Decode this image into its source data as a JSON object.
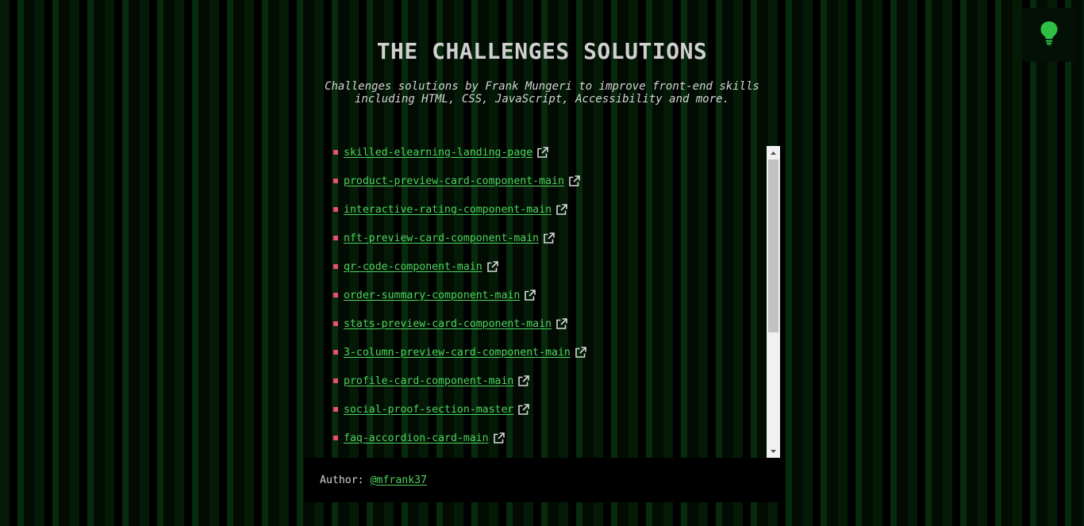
{
  "header": {
    "title": "THE CHALLENGES SOLUTIONS",
    "subtitle": "Challenges solutions by Frank Mungeri to improve front-end skills including HTML, CSS, JavaScript, Accessibility and more."
  },
  "theme_toggle": {
    "icon": "lightbulb-icon",
    "color": "#2fbf45"
  },
  "challenges": [
    "skilled-elearning-landing-page",
    "product-preview-card-component-main",
    "interactive-rating-component-main",
    "nft-preview-card-component-main",
    "qr-code-component-main",
    "order-summary-component-main",
    "stats-preview-card-component-main",
    "3-column-preview-card-component-main",
    "profile-card-component-main",
    "social-proof-section-master",
    "faq-accordion-card-main"
  ],
  "footer": {
    "label": "Author:",
    "handle": "@mfrank37"
  },
  "colors": {
    "link": "#4fd35e",
    "bullet": "#e84f70",
    "text": "#d4d4d4"
  }
}
